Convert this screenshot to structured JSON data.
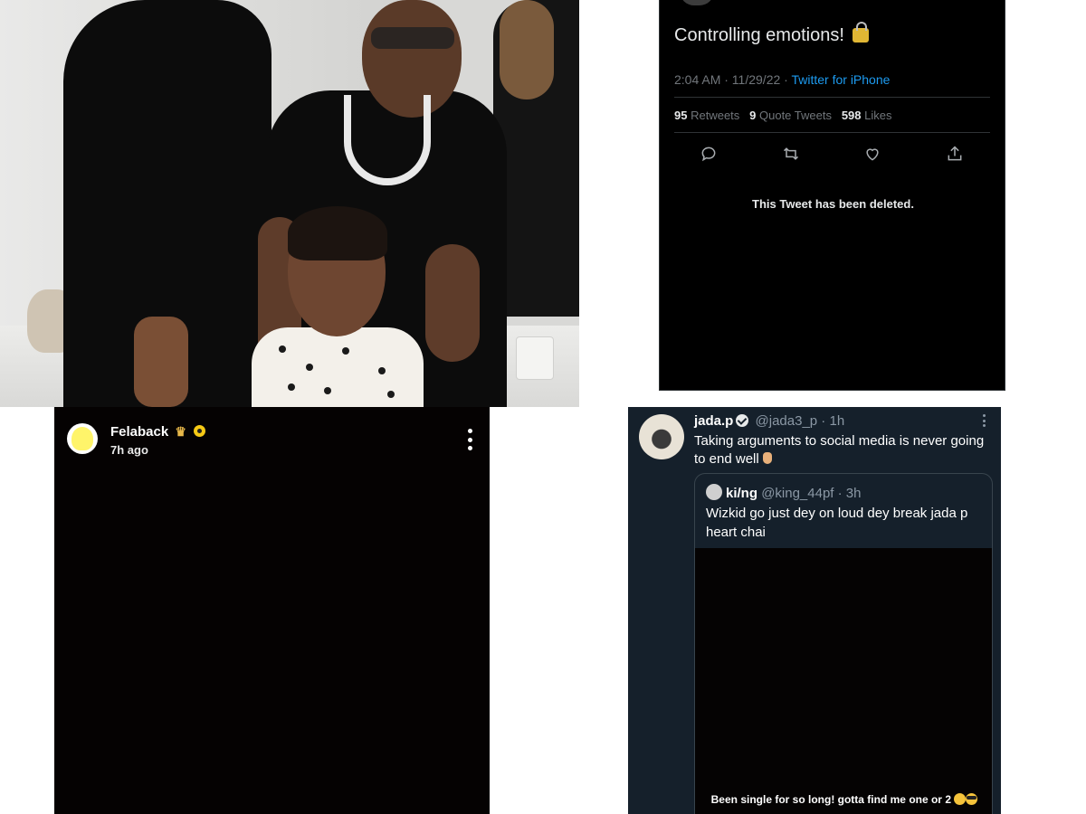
{
  "top_tweet": {
    "text": "Controlling emotions!",
    "timestamp": "2:04 AM · 11/29/22 ·",
    "source": "Twitter for iPhone",
    "retweets_count": "95",
    "retweets_label": "Retweets",
    "quote_tweets_count": "9",
    "quote_tweets_label": "Quote Tweets",
    "likes_count": "598",
    "likes_label": "Likes",
    "actions": [
      "reply-icon",
      "retweet-icon",
      "like-icon",
      "share-icon"
    ],
    "deleted_notice": "This Tweet has been deleted.",
    "emoji": "lock-icon"
  },
  "snap_story": {
    "username": "Felaback",
    "timestamp": "7h ago",
    "badge_icons": [
      "crown-icon",
      "star-badge-icon"
    ]
  },
  "quote_tweet": {
    "display_name": "jada.p",
    "handle_time": "@jada3_p · 1h",
    "text": "Taking arguments to social media is never going to end well",
    "quoted": {
      "display_name": "ki/ng",
      "handle_time": "@king_44pf · 3h",
      "text": "Wizkid go just dey on loud dey break jada p heart chai",
      "media_caption": "Been single for so long!  gotta find me one or 2"
    }
  },
  "colors": {
    "twitter_blue": "#1d9bf0",
    "dim_background": "#15202b",
    "snap_yellow": "#fff46a"
  }
}
